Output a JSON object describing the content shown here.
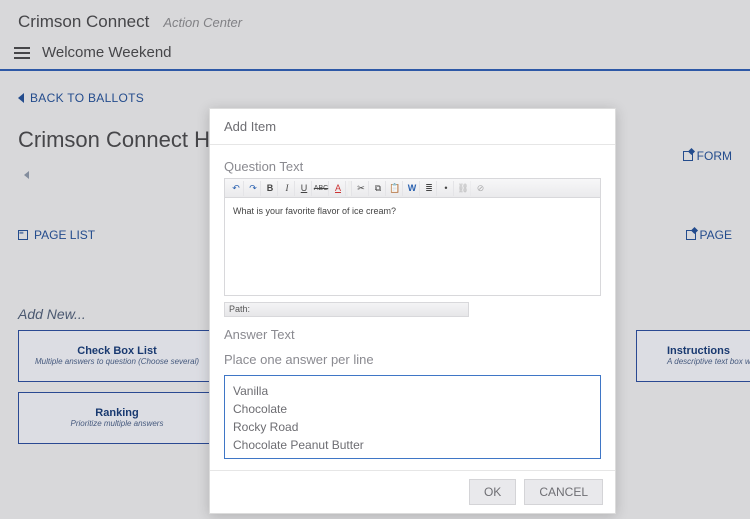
{
  "header": {
    "app_name": "Crimson Connect",
    "app_sub": "Action Center"
  },
  "orgbar": {
    "org_name": "Welcome Weekend"
  },
  "backlink": "BACK TO BALLOTS",
  "page_title": "Crimson Connect Help Test",
  "right_links": {
    "form": "FORM",
    "page": "PAGE"
  },
  "page_list": "PAGE LIST",
  "add_new": "Add New...",
  "tiles": {
    "checkbox": {
      "title": "Check Box List",
      "sub": "Multiple answers to question (Choose several)"
    },
    "instructions": {
      "title": "Instructions",
      "sub": "A descriptive text box with"
    },
    "ranking": {
      "title": "Ranking",
      "sub": "Prioritize multiple answers"
    }
  },
  "modal": {
    "title": "Add Item",
    "question_label": "Question Text",
    "question_value": "What is your favorite flavor of ice cream?",
    "path_label": "Path:",
    "answer_label": "Answer Text",
    "answer_hint": "Place one answer per line",
    "answer_value": "Vanilla\nChocolate\nRocky Road\nChocolate Peanut Butter",
    "ok": "OK",
    "cancel": "CANCEL",
    "toolbar": {
      "undo": "↶",
      "redo": "↷",
      "bold": "B",
      "italic": "I",
      "underline": "U",
      "strike": "ABC",
      "fontcolor": "A",
      "cut": "✂",
      "copy": "⧉",
      "paste": "📋",
      "pasteword": "W",
      "ol": "≣",
      "ul": "•",
      "link": "⛓",
      "unlink": "⊘"
    }
  }
}
